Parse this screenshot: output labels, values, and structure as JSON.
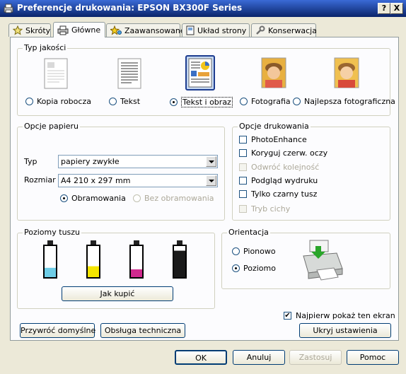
{
  "window": {
    "title": "Preferencje drukowania: EPSON BX300F Series",
    "help_btn": "?",
    "close_btn": "X"
  },
  "tabs": [
    {
      "label": "Skróty",
      "icon": "star-icon"
    },
    {
      "label": "Główne",
      "icon": "printer-icon",
      "active": true
    },
    {
      "label": "Zaawansowane",
      "icon": "sparkle-icon"
    },
    {
      "label": "Układ strony",
      "icon": "page-layout-icon"
    },
    {
      "label": "Konserwacja",
      "icon": "wrench-icon"
    }
  ],
  "quality": {
    "title": "Typ jakości",
    "options": [
      {
        "label": "Kopia robocza",
        "selected": false
      },
      {
        "label": "Tekst",
        "selected": false
      },
      {
        "label": "Tekst i obraz",
        "selected": true
      },
      {
        "label": "Fotografia",
        "selected": false
      },
      {
        "label": "Najlepsza fotograficzna",
        "selected": false
      }
    ]
  },
  "paper": {
    "title": "Opcje papieru",
    "type_label": "Typ",
    "type_value": "papiery zwykłe",
    "size_label": "Rozmiar",
    "size_value": "A4 210 x 297 mm",
    "border": "Obramowania",
    "borderless": "Bez obramowania"
  },
  "print_options": {
    "title": "Opcje drukowania",
    "items": [
      {
        "label": "PhotoEnhance",
        "checked": false,
        "disabled": false
      },
      {
        "label": "Koryguj czerw. oczy",
        "checked": false,
        "disabled": false
      },
      {
        "label": "Odwróć kolejność",
        "checked": false,
        "disabled": true
      },
      {
        "label": "Podgląd wydruku",
        "checked": false,
        "disabled": false
      },
      {
        "label": "Tylko czarny tusz",
        "checked": false,
        "disabled": false
      },
      {
        "label": "Tryb cichy",
        "checked": false,
        "disabled": true
      }
    ]
  },
  "ink": {
    "title": "Poziomy tuszu",
    "cartridges": [
      {
        "color": "cyan",
        "hex": "#6ecde6",
        "level": 0.3
      },
      {
        "color": "yellow",
        "hex": "#f5e600",
        "level": 0.35
      },
      {
        "color": "magenta",
        "hex": "#d02b8e",
        "level": 0.25
      },
      {
        "color": "black",
        "hex": "#1a1a1a",
        "level": 0.85
      }
    ],
    "buy_button": "Jak kupić"
  },
  "orientation": {
    "title": "Orientacja",
    "portrait": "Pionowo",
    "landscape": "Poziomo",
    "selected": "landscape"
  },
  "show_first": {
    "label": "Najpierw pokaż ten ekran",
    "checked": true
  },
  "buttons": {
    "restore": "Przywróć domyślne",
    "support": "Obsługa techniczna",
    "hide": "Ukryj ustawienia",
    "ok": "OK",
    "cancel": "Anuluj",
    "apply": "Zastosuj",
    "help": "Pomoc"
  }
}
